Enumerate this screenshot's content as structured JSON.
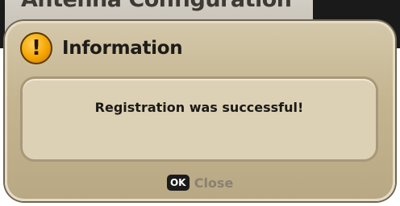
{
  "background_window": {
    "title": "Antenna Configuration"
  },
  "dialog": {
    "icon": "exclamation-warning-icon",
    "icon_glyph": "!",
    "title": "Information",
    "message": "Registration was successful!",
    "ok_key_label": "OK",
    "close_label": "Close"
  },
  "colors": {
    "dialog_fill": "#c4b48f",
    "message_fill": "#ddd1b5",
    "icon_orange": "#f5a400",
    "close_text": "#8a8170"
  }
}
